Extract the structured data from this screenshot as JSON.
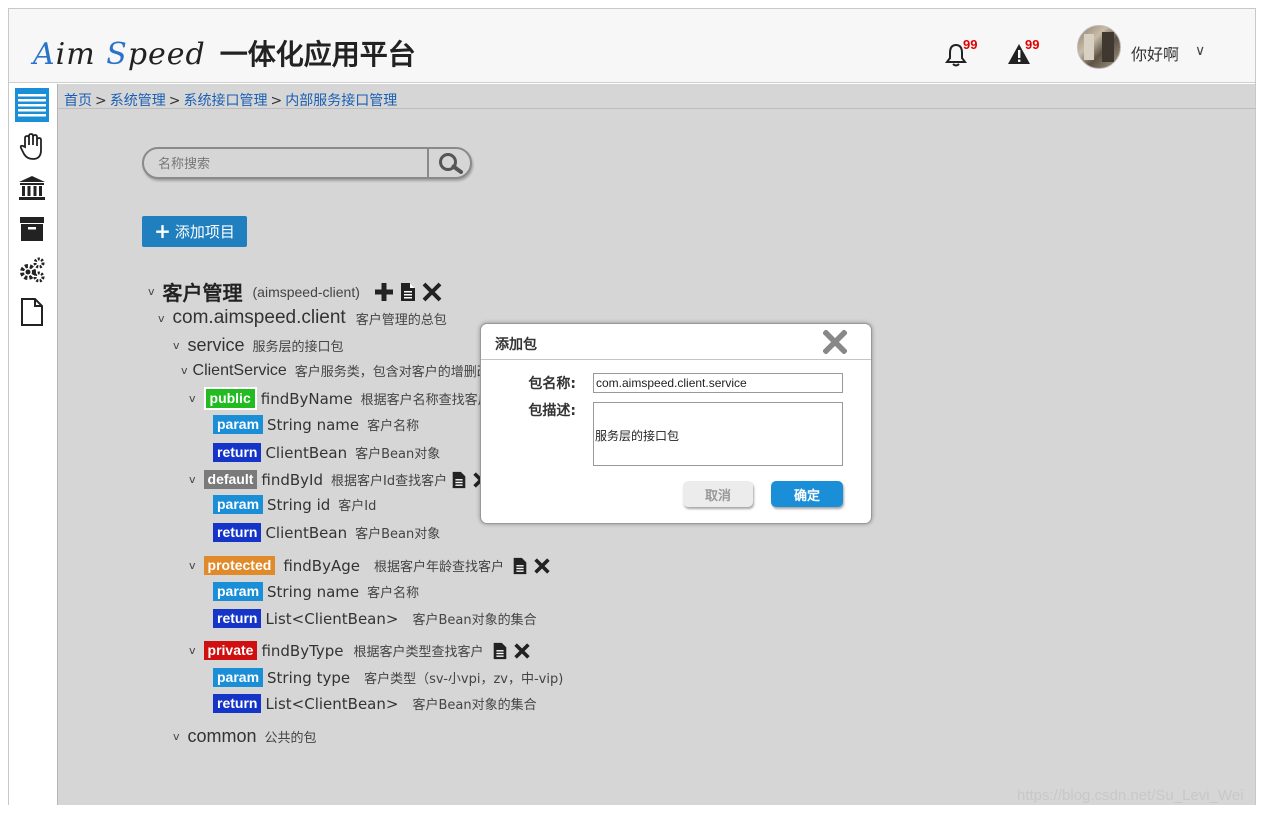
{
  "header": {
    "brand": "AimSpeed",
    "brand_parts": [
      "A",
      "im ",
      "S",
      "peed"
    ],
    "app_title": "一体化应用平台",
    "notifications_count": "99",
    "alerts_count": "99",
    "username": "你好啊"
  },
  "sidebar": {
    "items": [
      {
        "icon": "list-icon",
        "active": true
      },
      {
        "icon": "hand-icon",
        "active": false
      },
      {
        "icon": "bank-icon",
        "active": false
      },
      {
        "icon": "archive-icon",
        "active": false
      },
      {
        "icon": "gears-icon",
        "active": false
      },
      {
        "icon": "file-icon",
        "active": false
      }
    ]
  },
  "breadcrumb": [
    "首页",
    "系统管理",
    "系统接口管理",
    "内部服务接口管理"
  ],
  "breadcrumb_separator": ">",
  "search": {
    "placeholder": "名称搜索"
  },
  "add_project_label": "添加项目",
  "tree": {
    "project": {
      "name": "客户管理",
      "id": "(aimspeed-client)"
    },
    "package": {
      "name": "com.aimspeed.client",
      "desc": "客户管理的总包"
    },
    "service_pkg": {
      "name": "service",
      "desc": "服务层的接口包"
    },
    "class": {
      "name": "ClientService",
      "desc": "客户服务类，包含对客户的增删改"
    },
    "methods": [
      {
        "access": "public",
        "name": "findByName",
        "desc": "根据客户名称查找客户",
        "param": {
          "type": "String name",
          "desc": "客户名称"
        },
        "ret": {
          "type": "ClientBean",
          "desc": "客户Bean对象"
        }
      },
      {
        "access": "default",
        "name": "findById",
        "desc": "根据客户Id查找客户",
        "param": {
          "type": "String id",
          "desc": "客户Id"
        },
        "ret": {
          "type": "ClientBean",
          "desc": "客户Bean对象"
        }
      },
      {
        "access": "protected",
        "name": "findByAge",
        "desc": "根据客户年龄查找客户",
        "param": {
          "type": "String name",
          "desc": "客户名称"
        },
        "ret": {
          "type": "List<ClientBean>",
          "desc": "客户Bean对象的集合"
        }
      },
      {
        "access": "private",
        "name": "findByType",
        "desc": "根据客户类型查找客户",
        "param": {
          "type": "String type",
          "desc": "客户类型（sv-小vpi，zv，中-vip)"
        },
        "ret": {
          "type": "List<ClientBean>",
          "desc": "客户Bean对象的集合"
        }
      }
    ],
    "badges": {
      "param": "param",
      "return": "return"
    },
    "common_pkg": {
      "name": "common",
      "desc": "公共的包"
    }
  },
  "dialog": {
    "title": "添加包",
    "name_label": "包名称:",
    "name_value": "com.aimspeed.client.service",
    "desc_label": "包描述:",
    "desc_value": "服务层的接口包",
    "cancel_label": "取消",
    "ok_label": "确定"
  },
  "watermark": "https://blog.csdn.net/Su_Levi_Wei",
  "colors": {
    "accent": "#1a8fd8",
    "public": "#22bb22",
    "default": "#7a7a7a",
    "protected": "#e08a2a",
    "private": "#d01010",
    "param": "#1a8fd8",
    "return": "#1535c8",
    "count": "#e00000"
  }
}
